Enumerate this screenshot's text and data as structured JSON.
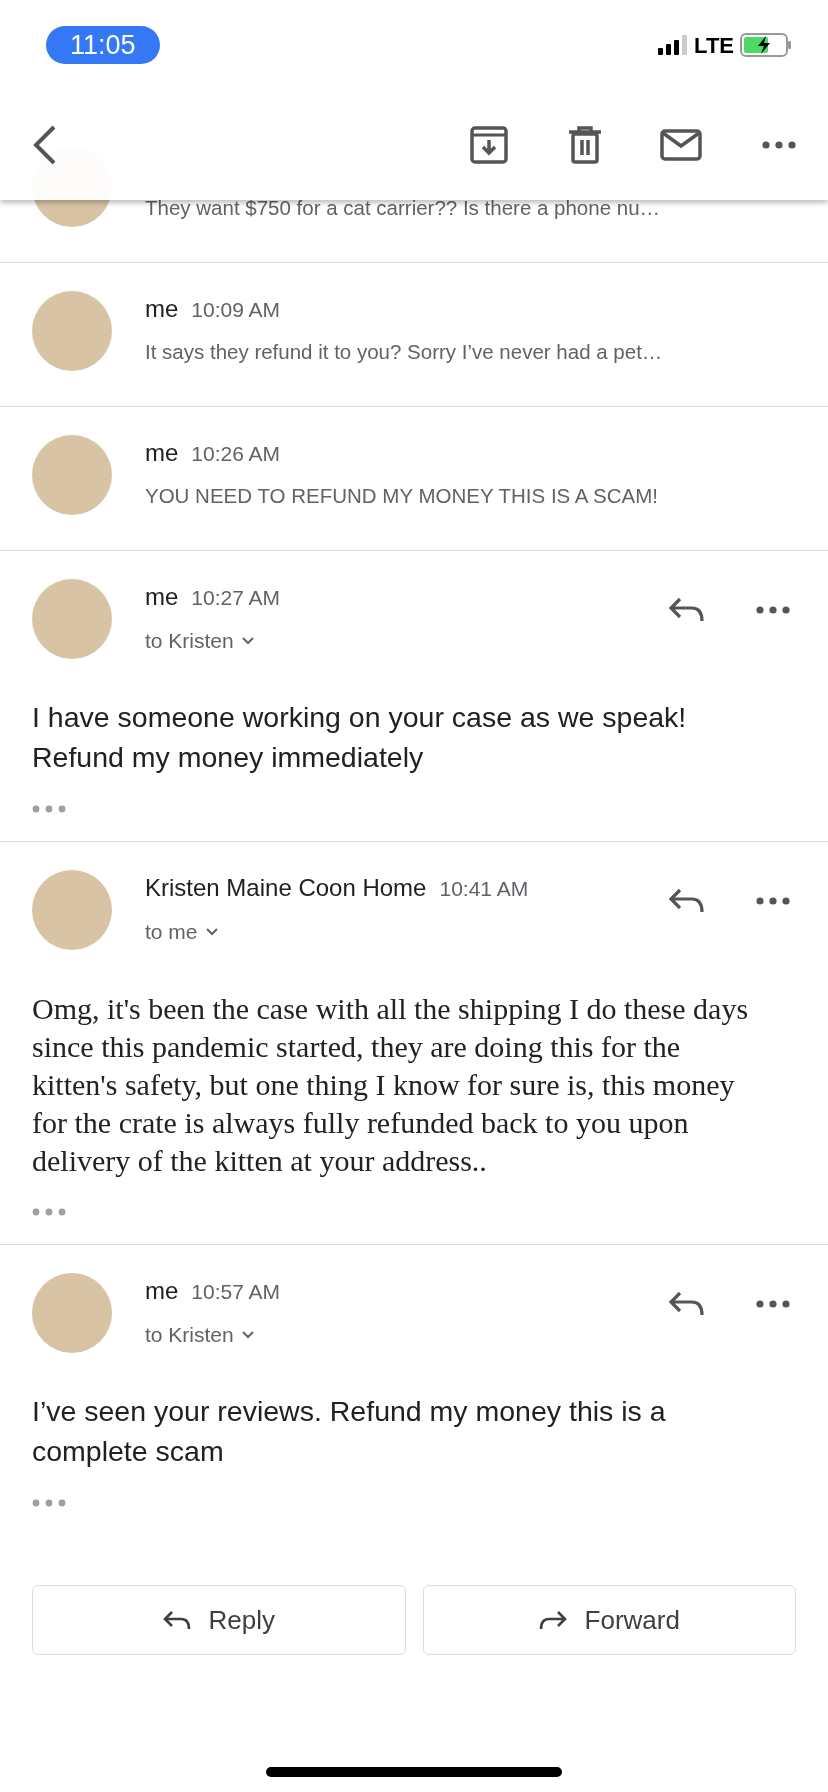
{
  "status_bar": {
    "time": "11:05",
    "network": "LTE"
  },
  "messages": [
    {
      "kind": "collapsed",
      "preview": "They want $750 for a cat carrier?? Is there a phone nu…"
    },
    {
      "kind": "collapsed",
      "sender": "me",
      "time": "10:09 AM",
      "preview": "It says they refund it to you? Sorry I’ve never had a pet…"
    },
    {
      "kind": "collapsed",
      "sender": "me",
      "time": "10:26 AM",
      "preview": "YOU NEED TO REFUND MY MONEY THIS IS A SCAM!"
    },
    {
      "kind": "plain",
      "sender": "me",
      "time": "10:27 AM",
      "recipient": "to Kristen",
      "body": "I have someone working on your case as we speak! Refund my money immediately"
    },
    {
      "kind": "html",
      "sender": "Kristen Maine Coon Home",
      "time": "10:41 AM",
      "recipient": "to me",
      "body": "Omg, it's been the case with all the shipping I do these days since this pandemic started, they are doing this for the kitten's safety, but one thing I know for sure is, this money for the crate is always fully refunded back to you upon delivery of the kitten at your address.."
    },
    {
      "kind": "plain",
      "sender": "me",
      "time": "10:57 AM",
      "recipient": "to Kristen",
      "body": "I’ve seen your reviews. Refund my money this is a complete scam"
    }
  ],
  "actions": [
    {
      "kind": "reply",
      "label": "Reply"
    },
    {
      "kind": "forward",
      "label": "Forward"
    }
  ]
}
